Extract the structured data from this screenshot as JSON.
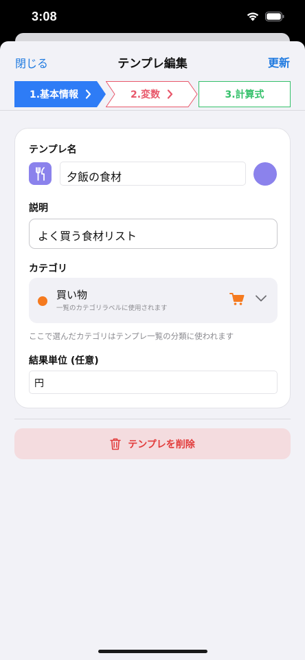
{
  "status": {
    "time": "3:08"
  },
  "nav": {
    "close_label": "閉じる",
    "title": "テンプレ編集",
    "update_label": "更新"
  },
  "steps": [
    {
      "label": "1.基本情報",
      "state": "active",
      "color": "#2e7cf6"
    },
    {
      "label": "2.変数",
      "state": "pending",
      "color": "#e8576a"
    },
    {
      "label": "3.計算式",
      "state": "pending",
      "color": "#34c06a"
    }
  ],
  "form": {
    "name_label": "テンプレ名",
    "name_value": "夕飯の食材",
    "name_icon": "fork-knife-icon",
    "theme_color": "#8b82ec",
    "desc_label": "説明",
    "desc_value": "よく買う食材リスト",
    "category_label": "カテゴリ",
    "category": {
      "name": "買い物",
      "subtitle": "一覧のカテゴリラベルに使用されます",
      "dot_color": "#f57a1f",
      "icon": "cart-icon"
    },
    "category_hint": "ここで選んだカテゴリはテンプレ一覧の分類に使われます",
    "unit_label": "結果単位 (任意)",
    "unit_value": "円"
  },
  "delete": {
    "label": "テンプレを削除",
    "color": "#e23b3b"
  }
}
